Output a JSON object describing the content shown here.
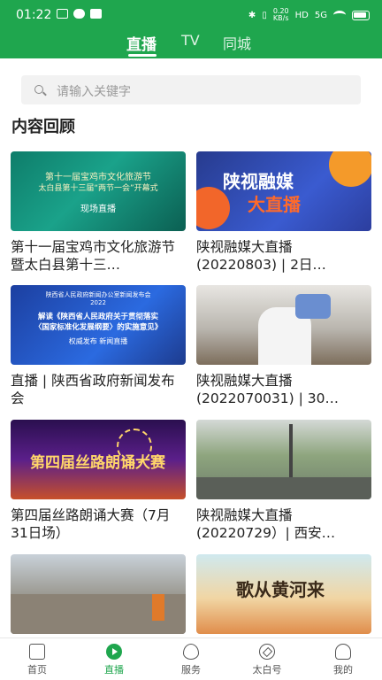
{
  "status_bar": {
    "time": "01:22",
    "net_speed_value": "0.20",
    "net_speed_unit": "KB/s",
    "hd_label": "HD",
    "signal_label": "5G"
  },
  "header": {
    "tabs": [
      {
        "label": "直播",
        "active": true
      },
      {
        "label": "TV",
        "active": false
      },
      {
        "label": "同城",
        "active": false
      }
    ]
  },
  "search": {
    "placeholder": "请输入关键字"
  },
  "section": {
    "title": "内容回顾"
  },
  "cards": [
    {
      "title": "第十一届宝鸡市文化旅游节暨太白县第十三…",
      "thumb_lines": [
        "第十一届宝鸡市文化旅游节",
        "太白县第十三届“两节一会”开幕式",
        "现场直播"
      ]
    },
    {
      "title": "陕视融媒大直播(20220803) | 2日…",
      "thumb_lines": [
        "陕视融媒",
        "大直播"
      ]
    },
    {
      "title": "直播 | 陕西省政府新闻发布会",
      "thumb_lines": [
        "陕西省人民政府新闻办公室新闻发布会",
        "2022",
        "解读《陕西省人民政府关于贯彻落实",
        "〈国家标准化发展纲要〉的实施意见》",
        "权威发布 新闻直播"
      ]
    },
    {
      "title": "陕视融媒大直播(2022070031) | 30…",
      "thumb_lines": []
    },
    {
      "title": "第四届丝路朗诵大赛（7月31日场）",
      "thumb_lines": [
        "第四届丝路朗诵大赛"
      ]
    },
    {
      "title": "陕视融媒大直播(20220729）| 西安…",
      "thumb_lines": []
    },
    {
      "title": "",
      "thumb_lines": []
    },
    {
      "title": "",
      "thumb_lines": [
        "歌从黄河来"
      ]
    }
  ],
  "bottom_nav": [
    {
      "label": "首页",
      "icon": "home-icon",
      "active": false
    },
    {
      "label": "直播",
      "icon": "live-play-icon",
      "active": true
    },
    {
      "label": "服务",
      "icon": "service-icon",
      "active": false
    },
    {
      "label": "太白号",
      "icon": "compass-icon",
      "active": false
    },
    {
      "label": "我的",
      "icon": "user-icon",
      "active": false
    }
  ],
  "colors": {
    "brand": "#1fa64e",
    "search_bg": "#f2f2f2"
  }
}
